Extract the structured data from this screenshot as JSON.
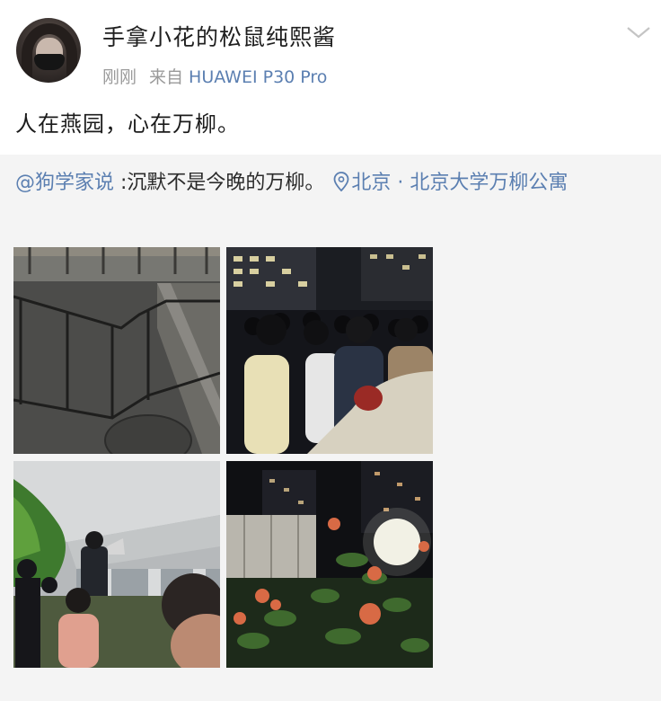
{
  "post": {
    "username": "手拿小花的松鼠纯熙酱",
    "time": "刚刚",
    "from_label": "来自",
    "device": "HUAWEI P30 Pro",
    "text": "人在燕园，心在万柳。"
  },
  "repost": {
    "mention": "@狗学家说",
    "text": " :沉默不是今晚的万柳。",
    "location": "北京 · 北京大学万柳公寓"
  },
  "photos": [
    {
      "icon": "photo-railing-pavement"
    },
    {
      "icon": "photo-night-crowd"
    },
    {
      "icon": "photo-person-megaphone"
    },
    {
      "icon": "photo-roses-night"
    }
  ],
  "colors": {
    "link": "#5b7fb1",
    "meta": "#9a9a9a",
    "card_bg": "#f4f4f4"
  }
}
